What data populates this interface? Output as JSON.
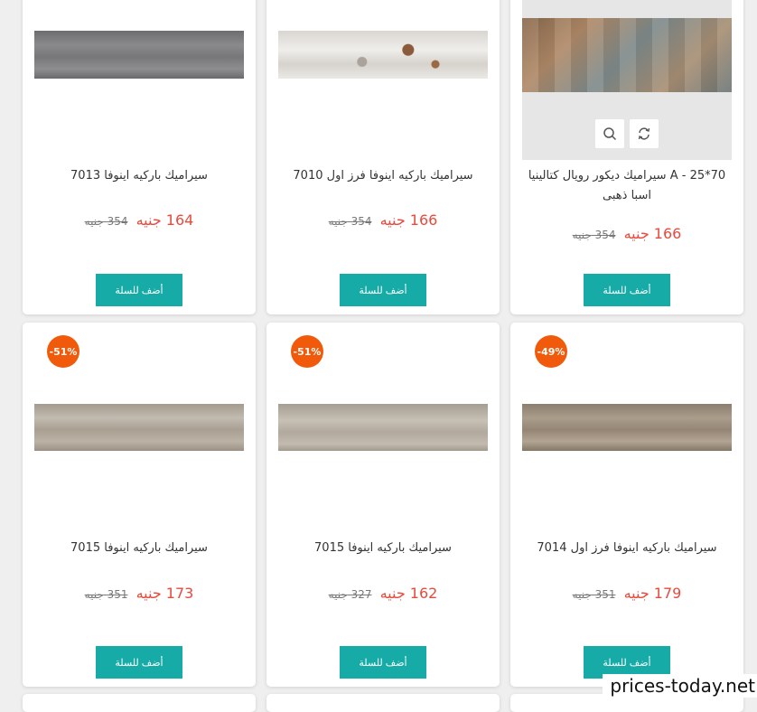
{
  "cart_label": "أضف للسلة",
  "currency": "جنيه",
  "watermark": "prices-today.net",
  "colors": {
    "price": "#e84a3c",
    "button": "#17aba7",
    "badge": "#f05a0a"
  },
  "products": [
    {
      "title": "7013 سيراميك باركيه اينوفا",
      "price": "164",
      "old_price": "354",
      "discount": ""
    },
    {
      "title": "7010 سيراميك باركيه اينوفا فرز اول",
      "price": "166",
      "old_price": "354",
      "discount": ""
    },
    {
      "title": "70*25 - A سيراميك ديكور رويال كتالينيا اسبا ذهبى",
      "price": "166",
      "old_price": "354",
      "discount": ""
    },
    {
      "title": "7015 سيراميك باركيه اينوفا",
      "price": "173",
      "old_price": "351",
      "discount": "-51%"
    },
    {
      "title": "7015 سيراميك باركيه اينوفا",
      "price": "162",
      "old_price": "327",
      "discount": "-51%"
    },
    {
      "title": "7014 سيراميك باركيه اينوفا فرز اول",
      "price": "179",
      "old_price": "351",
      "discount": "-49%"
    }
  ]
}
